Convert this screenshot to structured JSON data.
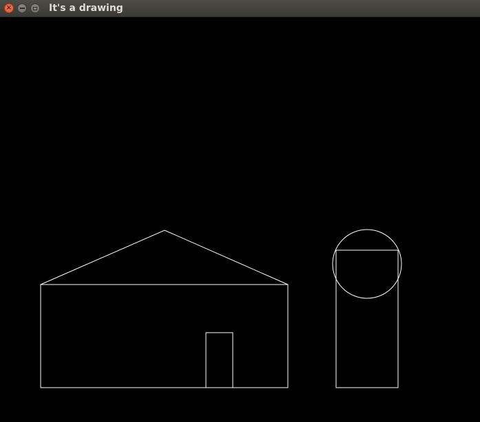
{
  "window": {
    "title": "It's a drawing",
    "background": "#000000",
    "stroke_color": "#ffffff",
    "controls": {
      "close_icon": "close-icon",
      "minimize_icon": "minimize-icon",
      "maximize_icon": "maximize-icon"
    }
  }
}
